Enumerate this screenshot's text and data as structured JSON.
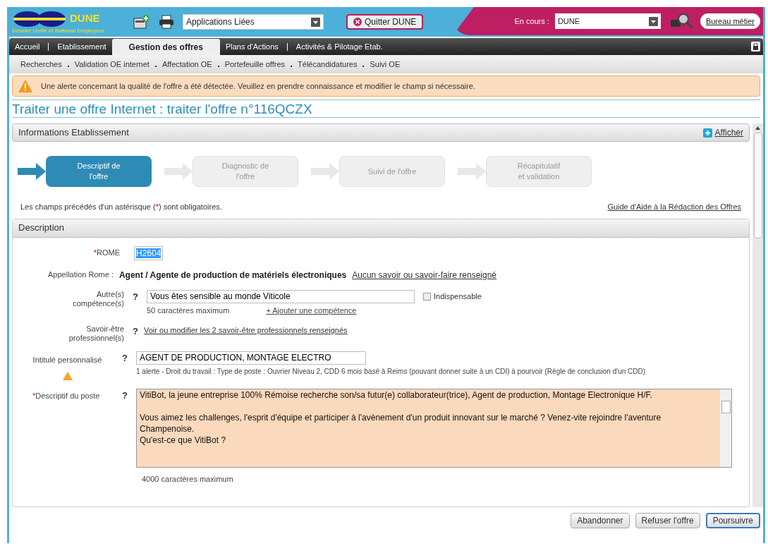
{
  "header": {
    "logo": {
      "name": "DUNE",
      "tagline": "Dossier Unifié et National Employeur"
    },
    "apps_select": {
      "value": "Applications Liées"
    },
    "quit_button": "Quitter DUNE",
    "current": {
      "label": "En cours :",
      "value": "DUNE"
    },
    "bureau_link": "Bureau métier"
  },
  "nav": [
    {
      "label": "Accueil",
      "selected": false
    },
    {
      "label": "Etablissement",
      "selected": false
    },
    {
      "label": "Gestion des offres",
      "selected": true
    },
    {
      "label": "Plans d'Actions",
      "selected": false
    },
    {
      "label": "Activités & Pilotage Etab.",
      "selected": false
    }
  ],
  "subnav": [
    "Recherches",
    "Validation OE internet",
    "Affectation OE",
    "Portefeuille offres",
    "Télécandidatures",
    "Suivi OE"
  ],
  "alert": "Une alerte concernant la qualité de l'offre a été détectée. Veuillez en prendre connaissance et modifier le champ si nécessaire.",
  "page_title": "Traiter une offre Internet : traiter l'offre n°116QCZX",
  "info_section": {
    "title": "Informations Etablissement",
    "action": "Afficher"
  },
  "steps": [
    {
      "label": "Descriptif de l'offre",
      "selected": true
    },
    {
      "label": "Diagnostic de l'offre",
      "selected": false
    },
    {
      "label": "Suivi de l'offre",
      "selected": false
    },
    {
      "label": "Récapitulatif et validation",
      "selected": false
    }
  ],
  "required_note": {
    "before": "Les champs précédés d'un astérisque (",
    "mark": "*",
    "after": ") sont obligatoires."
  },
  "guide_link": "Guide d'Aide à la Rédaction des Offres",
  "description_section": {
    "title": "Description"
  },
  "fields": [
    {
      "kind": "code",
      "mark": "*",
      "label": "ROME",
      "value": "H2604"
    },
    {
      "kind": "appellation",
      "label": "Appellation Rome :",
      "value": "Agent / Agente de production de matériels électroniques",
      "link": "Aucun savoir ou savoir-faire renseigné"
    },
    {
      "kind": "competence",
      "label": "Autre(s) compétence(s)",
      "help": "?",
      "value": "Vous êtes sensible au monde Viticole",
      "checkbox": {
        "label": "Indispensable",
        "checked": false
      },
      "hint": "50 caractères maximum",
      "link": "+ Ajouter une compétence"
    },
    {
      "kind": "link",
      "label": "Savoir-être professionnel(s)",
      "help": "?",
      "link": "Voir ou modifier les 2 savoir-être professionnels renseignés"
    },
    {
      "kind": "alert_input",
      "label": "Intitulé personnalisé",
      "help": "?",
      "value": "AGENT DE PRODUCTION, MONTAGE ELECTRO",
      "alert": "1 alerte - Droit du travail : Type de poste : Ouvrier Niveau 2, CDD 6 mois basé à Reims (pouvant donner suite à un CDI) à pourvoir (Règle de conclusion d'un CDD)"
    },
    {
      "kind": "textarea",
      "mark": "*",
      "label": "Descriptif du poste",
      "help": "?",
      "value": "VitiBot, la jeune entreprise 100% Rémoise recherche son/sa futur(e) collaborateur(trice), Agent de production, Montage Electronique H/F.\n\nVous aimez les challenges, l'esprit d'équipe et participer à l'avènement d'un produit innovant sur le marché ? Venez-vite rejoindre l'aventure Champenoise.\nQu'est-ce que VitiBot ?",
      "hint": "4000 caractères maximum"
    }
  ],
  "buttons": [
    {
      "label": "Abandonner",
      "kind": "secondary"
    },
    {
      "label": "Refuser l'offre",
      "kind": "secondary"
    },
    {
      "label": "Poursuivre",
      "kind": "primary"
    }
  ]
}
